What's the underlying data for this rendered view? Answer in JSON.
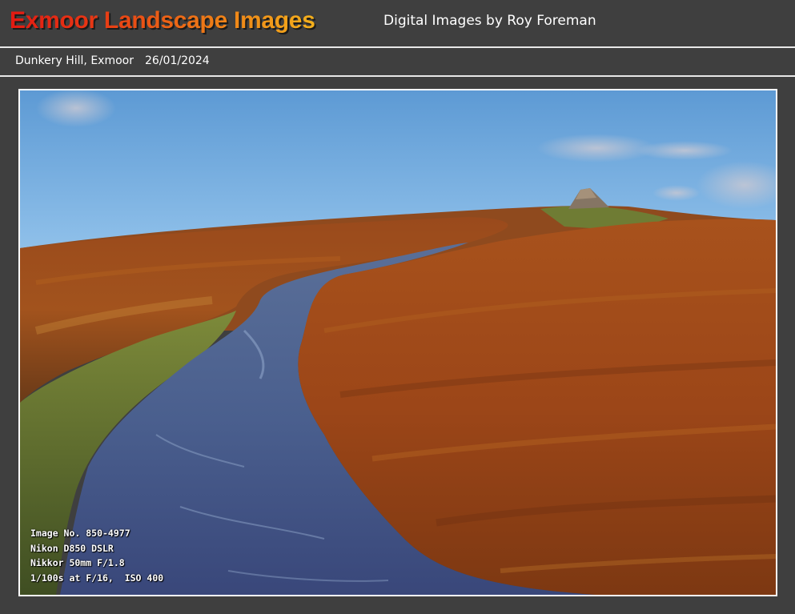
{
  "header": {
    "title": "Exmoor Landscape Images",
    "subtitle": "Digital Images by Roy Foreman"
  },
  "caption": {
    "location": "Dunkery Hill, Exmoor",
    "date": "26/01/2024"
  },
  "photo": {
    "exif": {
      "image_no": "Image No. 850-4977",
      "camera": "Nikon D850 DSLR",
      "lens": "Nikkor 50mm F/1.8",
      "settings": "1/100s at F/16,  ISO 400"
    }
  },
  "colors": {
    "background": "#3f3f3f",
    "title_gradient_start": "#e21a12",
    "title_gradient_end": "#f3b01c",
    "rule": "#e8e8e8"
  }
}
